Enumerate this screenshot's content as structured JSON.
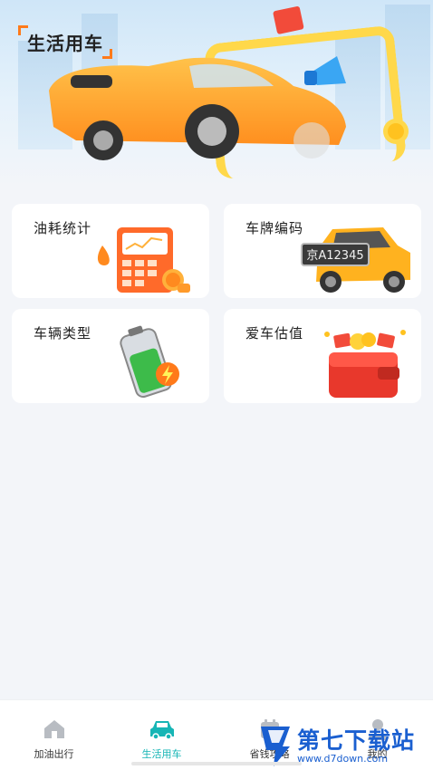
{
  "banner": {
    "title": "生活用车"
  },
  "cards": [
    {
      "label": "油耗统计"
    },
    {
      "label": "车牌编码",
      "plate_text": "京A12345"
    },
    {
      "label": "车辆类型"
    },
    {
      "label": "爱车估值"
    }
  ],
  "nav": [
    {
      "label": "加油出行",
      "icon": "home-icon"
    },
    {
      "label": "生活用车",
      "icon": "car-icon",
      "active": true
    },
    {
      "label": "省钱攻略",
      "icon": "calendar-icon"
    },
    {
      "label": "我的",
      "icon": "user-icon"
    }
  ],
  "watermark": {
    "brand": "第七下载站",
    "url": "www.d7down.com"
  },
  "colors": {
    "accent": "#16b5b5",
    "brand_orange": "#ff7a1a",
    "watermark_blue": "#1a5fd0"
  }
}
